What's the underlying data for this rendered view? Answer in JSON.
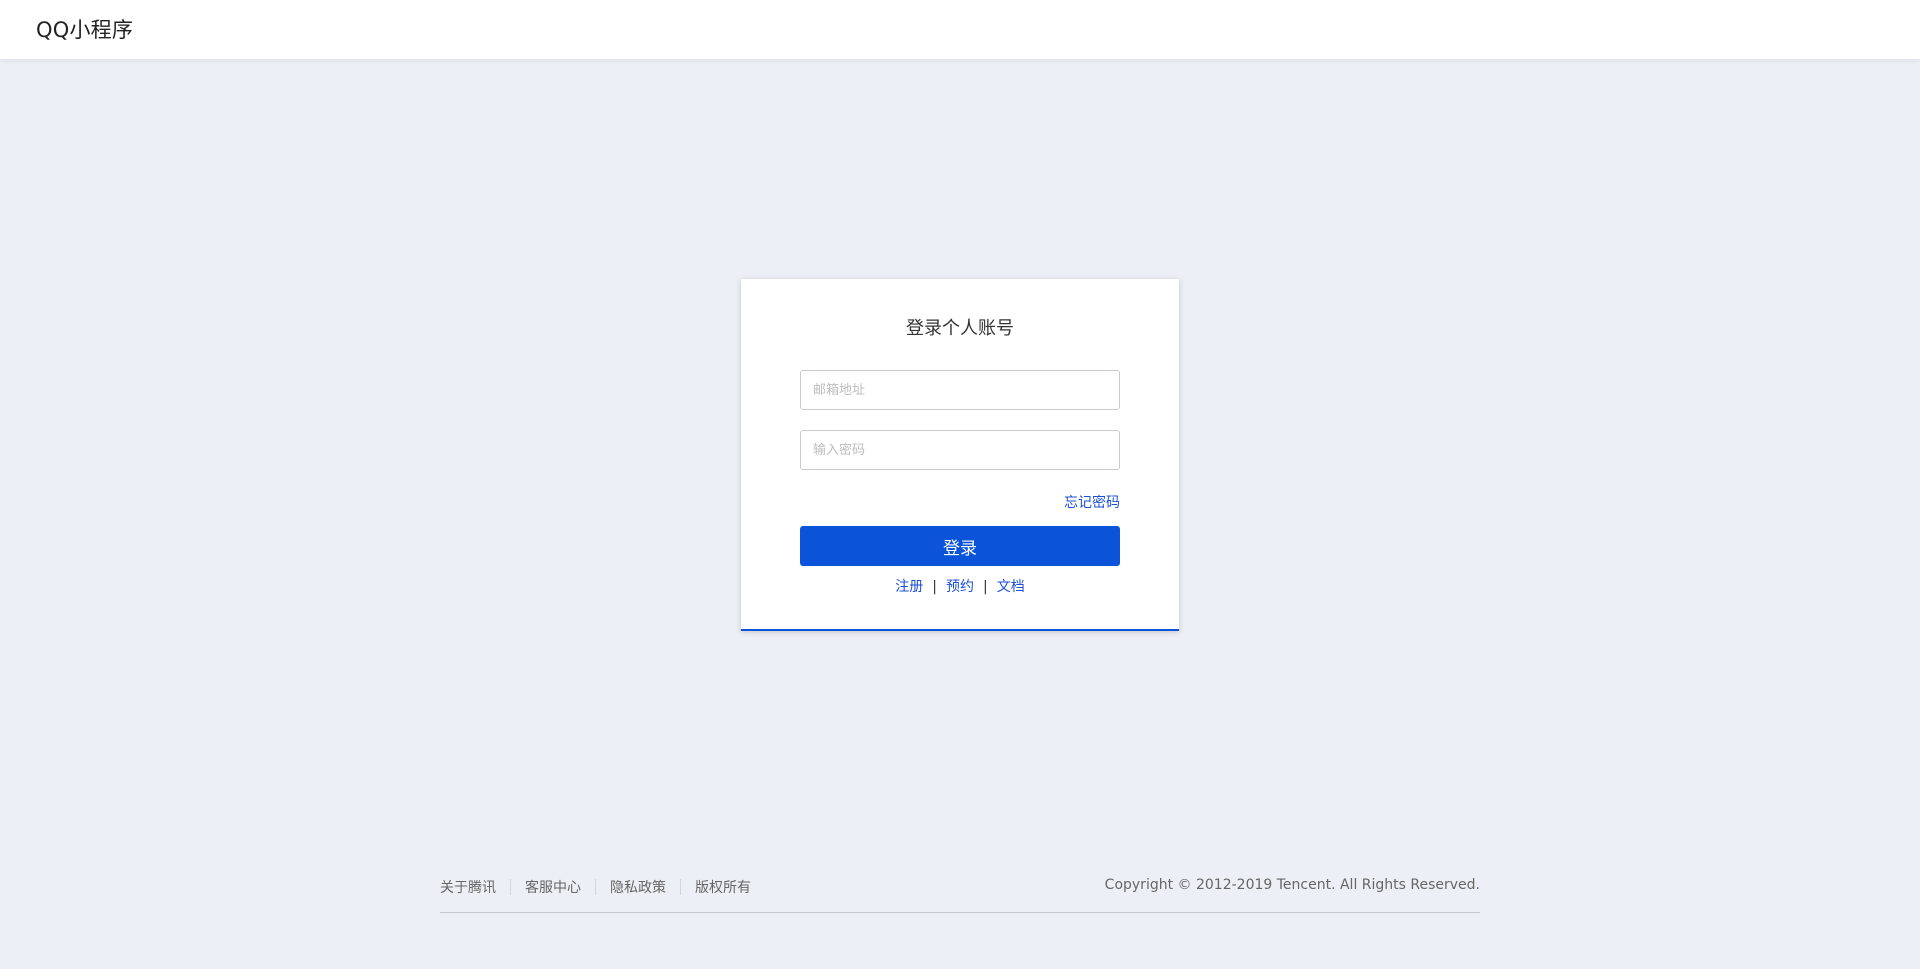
{
  "header": {
    "brand": "QQ小程序"
  },
  "login": {
    "title": "登录个人账号",
    "email_placeholder": "邮箱地址",
    "password_placeholder": "输入密码",
    "forgot_password": "忘记密码",
    "login_button": "登录",
    "links": {
      "register": "注册",
      "reserve": "预约",
      "docs": "文档",
      "separator": "|"
    }
  },
  "footer": {
    "links": [
      "关于腾讯",
      "客服中心",
      "隐私政策",
      "版权所有"
    ],
    "copyright": "Copyright © 2012-2019 Tencent. All Rights Reserved."
  },
  "colors": {
    "accent": "#0b54d9",
    "link": "#1b4fd6",
    "background": "#eceff5"
  }
}
